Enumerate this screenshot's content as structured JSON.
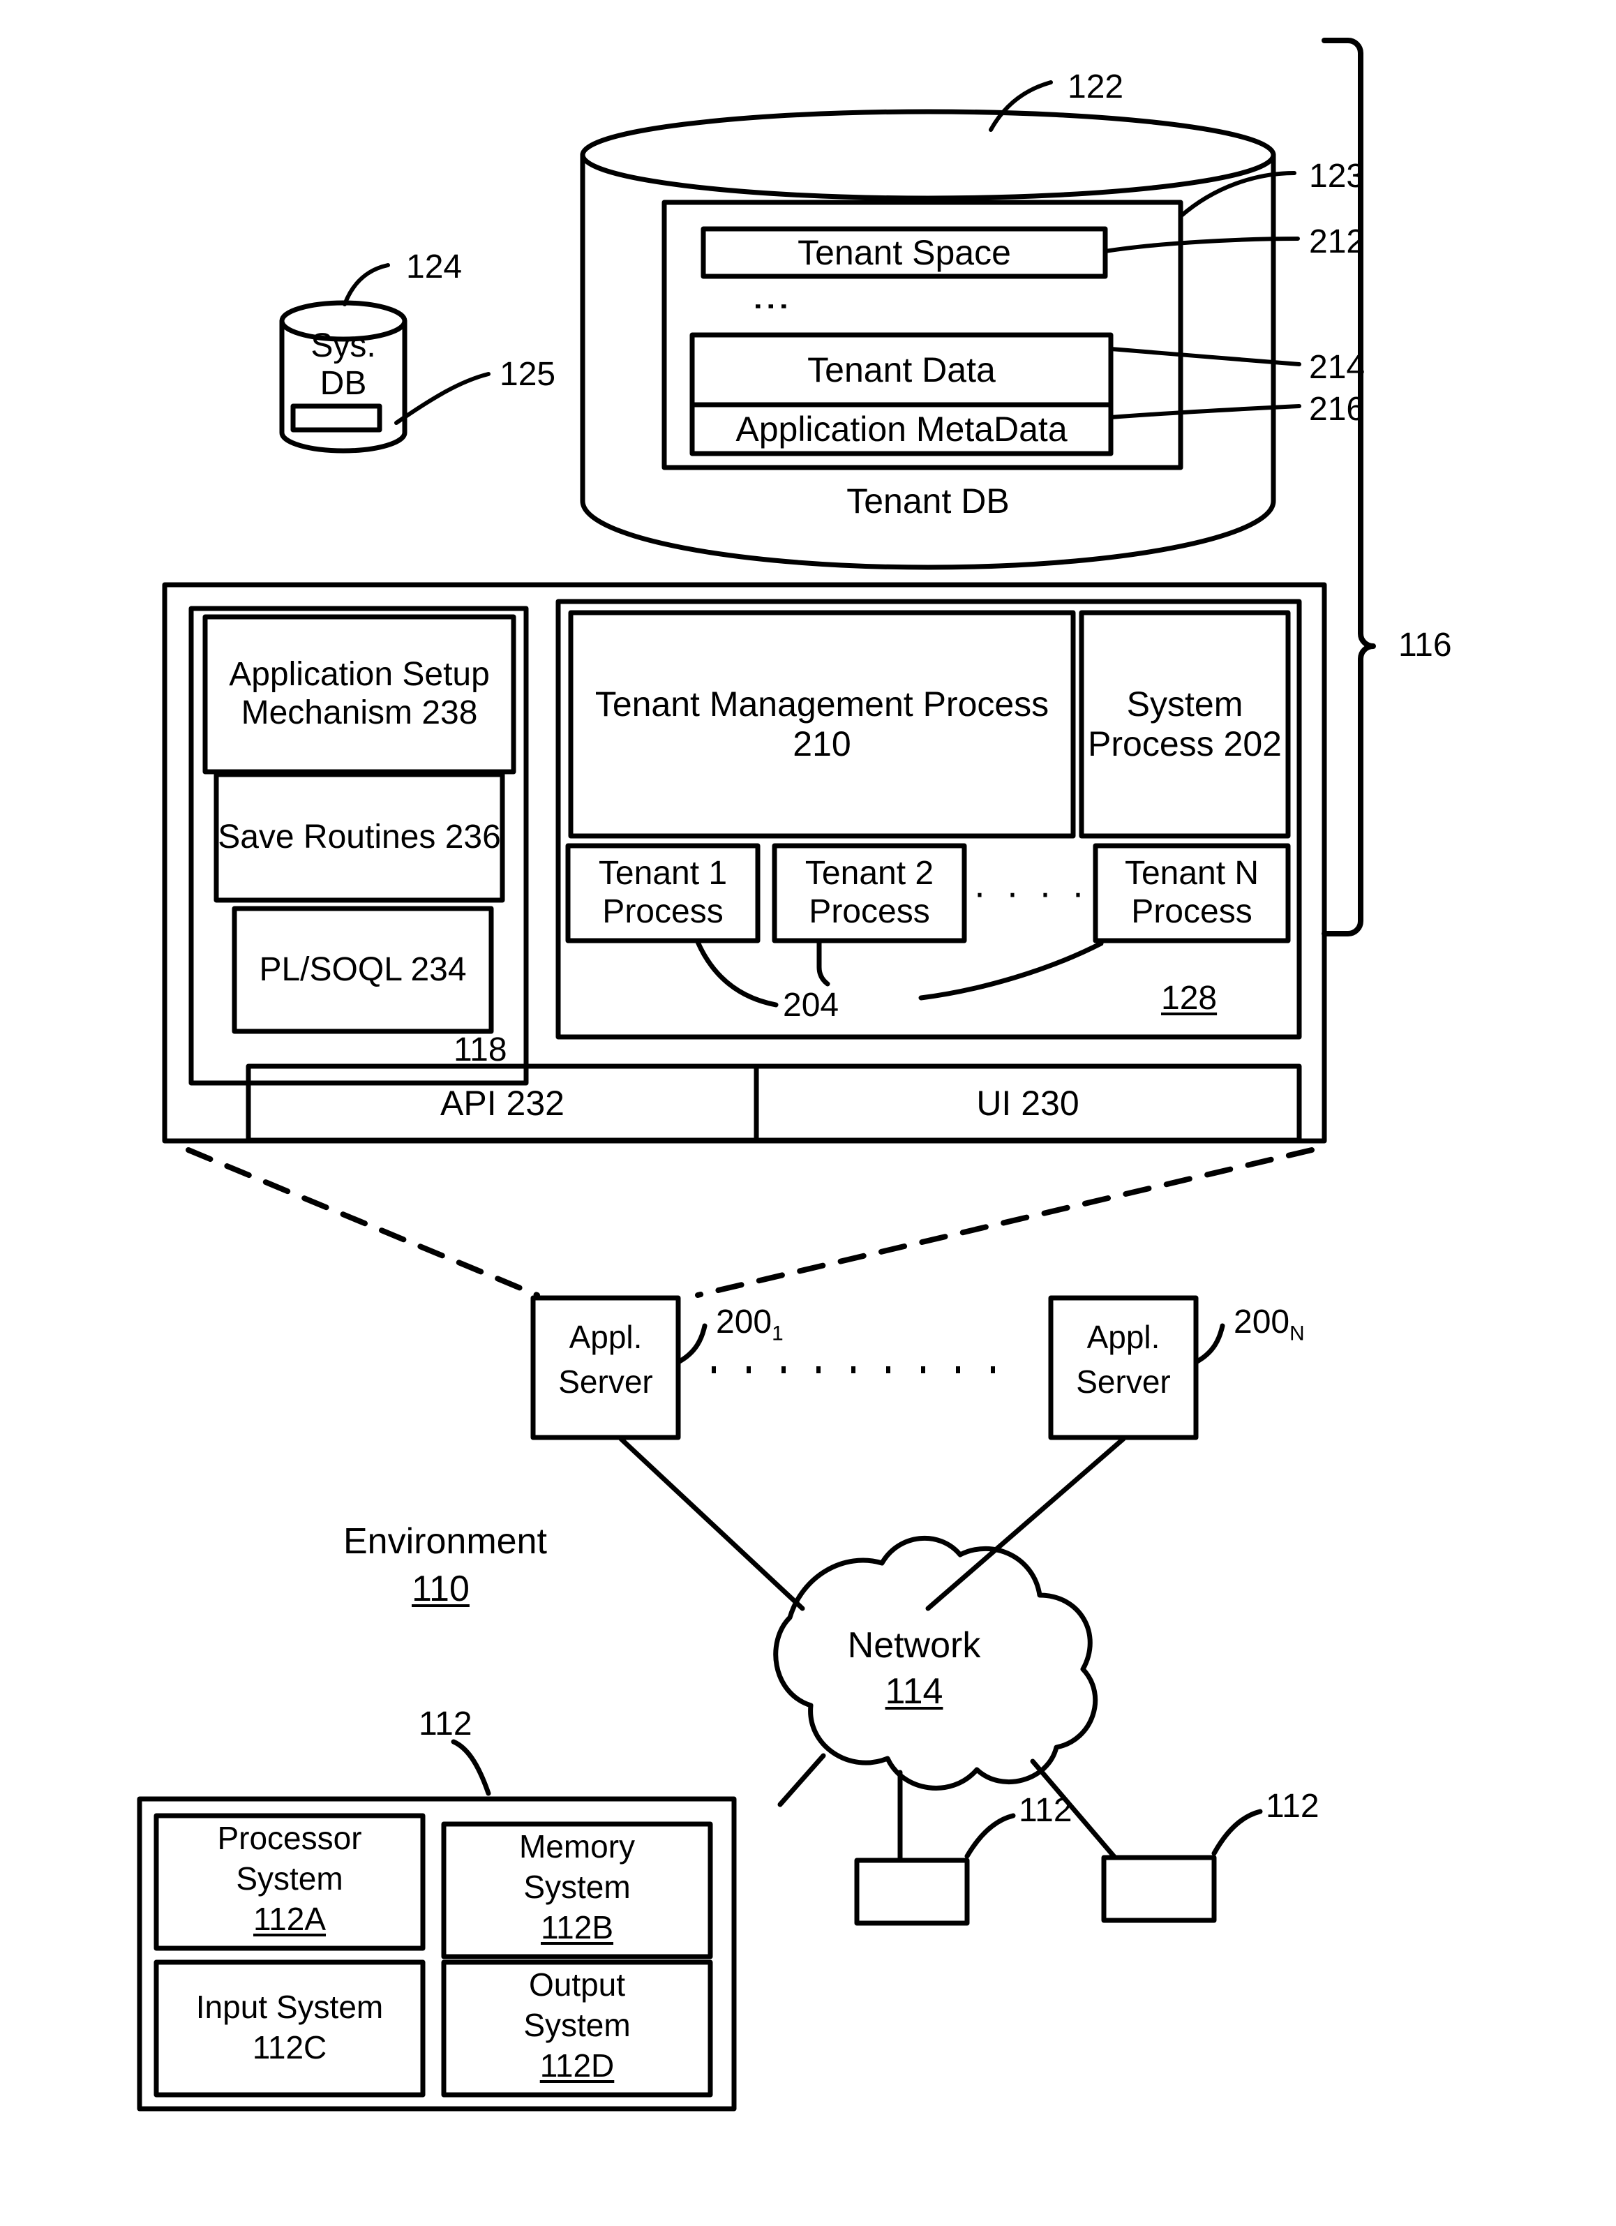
{
  "figure": {
    "type": "patent-block-diagram",
    "background": "#ffffff",
    "ink": "#000000"
  },
  "tenant_db": {
    "cylinder_label": "Tenant DB",
    "ref_cylinder": "122",
    "ref_inner_container": "123",
    "rows": [
      {
        "label": "Tenant Space",
        "ref": "212"
      },
      {
        "label": "Tenant Data",
        "ref": "214"
      },
      {
        "label": "Application MetaData",
        "ref": "216"
      }
    ],
    "vertical_ellipsis": "⋮"
  },
  "sys_db": {
    "line1": "Sys.",
    "line2": "DB",
    "ref_cylinder": "124",
    "ref_slot": "125"
  },
  "app_platform": {
    "ref_bracket": "116",
    "left_column": {
      "ref": "118",
      "boxes": [
        {
          "label": "Application Setup Mechanism 238"
        },
        {
          "label": "Save Routines 236"
        },
        {
          "label": "PL/SOQL 234"
        }
      ]
    },
    "process_space": {
      "ref": "128",
      "ref_tenant_processes": "204",
      "tenant_management": "Tenant Management Process 210",
      "system_process": "System Process 202",
      "tenant_processes": [
        "Tenant 1 Process",
        "Tenant 2 Process",
        "Tenant N Process"
      ],
      "process_ellipsis": "· · · ·"
    },
    "bottom_bar": {
      "api": "API 232",
      "ui": "UI 230"
    }
  },
  "app_servers": [
    {
      "line1": "Appl.",
      "line2": "Server",
      "ref": "200",
      "ref_sub": "1"
    },
    {
      "line1": "Appl.",
      "line2": "Server",
      "ref": "200",
      "ref_sub": "N"
    }
  ],
  "environment": {
    "label": "Environment",
    "ref": "110"
  },
  "network": {
    "label": "Network",
    "ref": "114"
  },
  "user_system": {
    "ref": "112",
    "boxes": [
      {
        "line1": "Processor",
        "line2": "System",
        "ref": "112A"
      },
      {
        "line1": "Memory",
        "line2": "System",
        "ref": "112B"
      },
      {
        "line1": "Input System",
        "line2": "",
        "ref": "112C"
      },
      {
        "line1": "Output",
        "line2": "System",
        "ref": "112D"
      }
    ]
  },
  "client_terminals": [
    {
      "ref": "112"
    },
    {
      "ref": "112"
    }
  ]
}
